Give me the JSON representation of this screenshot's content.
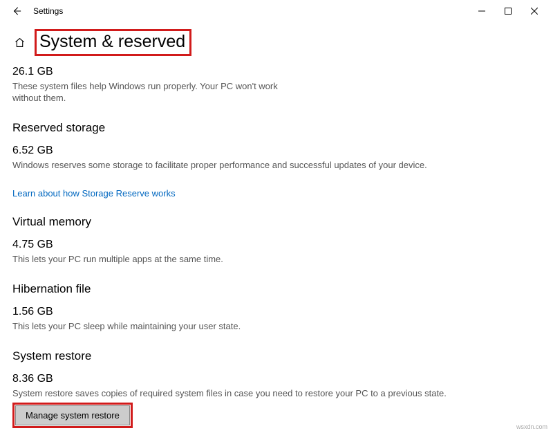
{
  "titlebar": {
    "title": "Settings"
  },
  "header": {
    "page_title": "System & reserved"
  },
  "section_top": {
    "size": "26.1 GB",
    "desc": "These system files help Windows run properly. Your PC won't work without them."
  },
  "reserved": {
    "title": "Reserved storage",
    "size": "6.52 GB",
    "desc": "Windows reserves some storage to facilitate proper performance and successful updates of your device.",
    "link": "Learn about how Storage Reserve works"
  },
  "virtual": {
    "title": "Virtual memory",
    "size": "4.75 GB",
    "desc": "This lets your PC run multiple apps at the same time."
  },
  "hibernation": {
    "title": "Hibernation file",
    "size": "1.56 GB",
    "desc": "This lets your PC sleep while maintaining your user state."
  },
  "restore": {
    "title": "System restore",
    "size": "8.36 GB",
    "desc": "System restore saves copies of required system files in case you need to restore your PC to a previous state.",
    "button": "Manage system restore"
  },
  "watermark": "wsxdn.com"
}
